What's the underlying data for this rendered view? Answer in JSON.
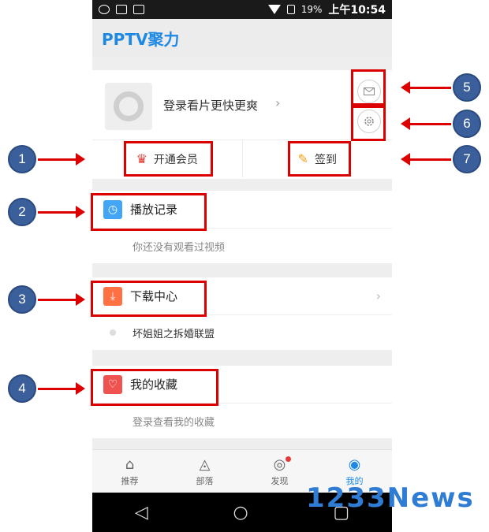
{
  "status_bar": {
    "battery": "19%",
    "time": "上午10:54"
  },
  "app": {
    "logo": "PPTV聚力",
    "brand_color": "#1e88e5"
  },
  "profile": {
    "login_text": "登录看片更快更爽",
    "chevron": "›",
    "tabs": [
      {
        "label": "开通会员",
        "icon": "crown-icon"
      },
      {
        "label": "签到",
        "icon": "sign-in-icon"
      }
    ]
  },
  "sections": {
    "history": {
      "title": "播放记录",
      "subtitle": "你还没有观看过视频",
      "icon_color": "#42a5f5"
    },
    "download": {
      "title": "下载中心",
      "item": "坏姐姐之拆婚联盟",
      "icon_color": "#ff7043"
    },
    "favorites": {
      "title": "我的收藏",
      "subtitle": "登录查看我的收藏",
      "icon_color": "#ef5350"
    }
  },
  "bottom_nav": [
    {
      "label": "推荐",
      "icon": "home-icon"
    },
    {
      "label": "部落",
      "icon": "tribe-icon"
    },
    {
      "label": "发现",
      "icon": "discover-icon"
    },
    {
      "label": "我的",
      "icon": "user-icon",
      "active": true
    }
  ],
  "annotations": [
    "1",
    "2",
    "3",
    "4",
    "5",
    "6",
    "7"
  ],
  "watermark": "1233News",
  "annotation_color": "#dd0000"
}
